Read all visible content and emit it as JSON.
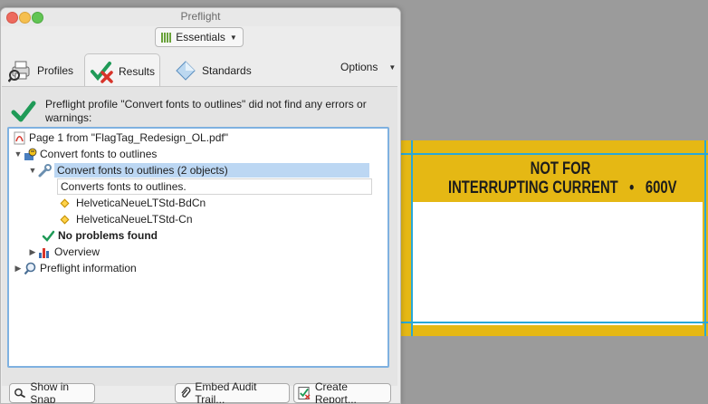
{
  "window": {
    "title": "Preflight"
  },
  "toolbar": {
    "workspace_label": "Essentials"
  },
  "tabs": {
    "profiles": "Profiles",
    "results": "Results",
    "standards": "Standards",
    "options": "Options"
  },
  "status": {
    "message": "Preflight profile \"Convert fonts to outlines\" did not find any errors or warnings:"
  },
  "tree": {
    "page_item": "Page 1 from \"FlagTag_Redesign_OL.pdf\"",
    "profile_item": "Convert fonts to outlines",
    "fixup_item": "Convert fonts to outlines (2 objects)",
    "fixup_description": "Converts fonts to outlines.",
    "fonts": [
      "HelveticaNeueLTStd-BdCn",
      "HelveticaNeueLTStd-Cn"
    ],
    "no_problems": "No problems found",
    "overview": "Overview",
    "preflight_info": "Preflight information"
  },
  "buttons": {
    "show_in_snap": "Show in Snap",
    "embed_audit_trail": "Embed Audit Trail...",
    "create_report": "Create Report..."
  },
  "document": {
    "line1": "NOT FOR",
    "line2_left": "INTERRUPTING CURRENT",
    "line2_bullet": "•",
    "line2_right": "600V"
  },
  "colors": {
    "accent": "#28a8d8",
    "band": "#e5b814",
    "selection": "#bcd7f3",
    "check": "#1f9a57"
  }
}
